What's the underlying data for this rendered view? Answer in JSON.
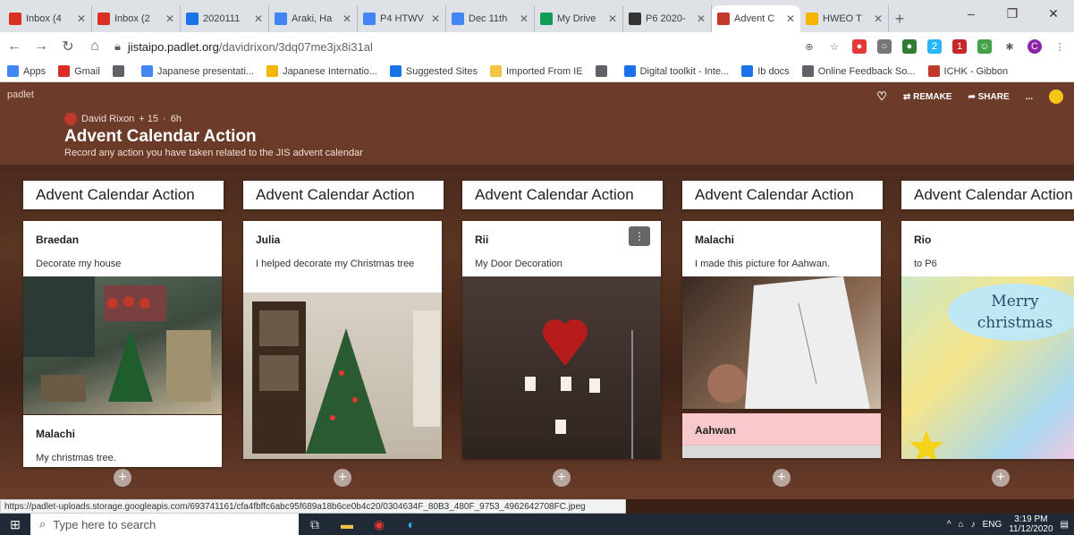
{
  "browser": {
    "tabs": [
      {
        "title": "Inbox (4",
        "color": "#d93025"
      },
      {
        "title": "Inbox (2",
        "color": "#d93025"
      },
      {
        "title": "2020111",
        "color": "#1a73e8"
      },
      {
        "title": "Araki, Ha",
        "color": "#4285f4"
      },
      {
        "title": "P4 HTWV",
        "color": "#4285f4"
      },
      {
        "title": "Dec 11th",
        "color": "#4285f4"
      },
      {
        "title": "My Drive",
        "color": "#0f9d58"
      },
      {
        "title": "P6 2020-",
        "color": "#333333"
      },
      {
        "title": "Advent C",
        "color": "#c0392b"
      },
      {
        "title": "HWEO T",
        "color": "#f4b400"
      }
    ],
    "active_tab_index": 8,
    "url_host": "jistaipo.padlet.org",
    "url_path": "/davidrixon/3dq07me3jx8i31al",
    "bookmarks": [
      {
        "label": "Apps",
        "color": "#4285f4"
      },
      {
        "label": "Gmail",
        "color": "#d93025"
      },
      {
        "label": "",
        "color": "#5f6368"
      },
      {
        "label": "Japanese presentati...",
        "color": "#4285f4"
      },
      {
        "label": "Japanese Internatio...",
        "color": "#f4b400"
      },
      {
        "label": "Suggested Sites",
        "color": "#1a73e8"
      },
      {
        "label": "Imported From IE",
        "color": "#f4c542"
      },
      {
        "label": "",
        "color": "#5f6368"
      },
      {
        "label": "Digital toolkit - Inte...",
        "color": "#1a73e8"
      },
      {
        "label": "Ib docs",
        "color": "#1a73e8"
      },
      {
        "label": "Online Feedback So...",
        "color": "#5f6368"
      },
      {
        "label": "ICHK - Gibbon",
        "color": "#c0392b"
      }
    ],
    "status_url": "https://padlet-uploads.storage.googleapis.com/693741161/cfa4fbffc6abc95f689a18b6ce0b4c20/0304634F_80B3_480F_9753_4962642708FC.jpeg"
  },
  "padlet": {
    "brand": "padlet",
    "author": "David Rixon",
    "likes": "+ 15",
    "age": "6h",
    "title": "Advent Calendar Action",
    "description": "Record any action you have taken related to the JIS advent calendar",
    "actions": {
      "remake": "REMAKE",
      "share": "SHARE",
      "more": "..."
    },
    "columns": [
      {
        "title": "Advent Calendar Action",
        "posts": [
          {
            "name": "Braedan",
            "body": "Decorate my house",
            "image": "house-decor"
          },
          {
            "name": "Malachi",
            "body": "My christmas tree.",
            "image": ""
          }
        ]
      },
      {
        "title": "Advent Calendar Action",
        "posts": [
          {
            "name": "Julia",
            "body": "I helped decorate my Christmas tree",
            "image": "tree"
          }
        ]
      },
      {
        "title": "Advent Calendar Action",
        "posts": [
          {
            "name": "Rii",
            "body": "My Door Decoration",
            "image": "door"
          }
        ]
      },
      {
        "title": "Advent Calendar Action",
        "posts": [
          {
            "name": "Malachi",
            "body": "I made this picture for Aahwan.",
            "image": "drawing"
          },
          {
            "name": "Aahwan",
            "body": "",
            "image": ""
          }
        ]
      },
      {
        "title": "Advent Calendar Action",
        "posts": [
          {
            "name": "Rio",
            "body": "to P6",
            "image": "card",
            "image_text": "Merry christmas"
          }
        ]
      }
    ]
  },
  "taskbar": {
    "search_placeholder": "Type here to search",
    "lang": "ENG",
    "time": "3:19 PM",
    "date": "11/12/2020"
  }
}
